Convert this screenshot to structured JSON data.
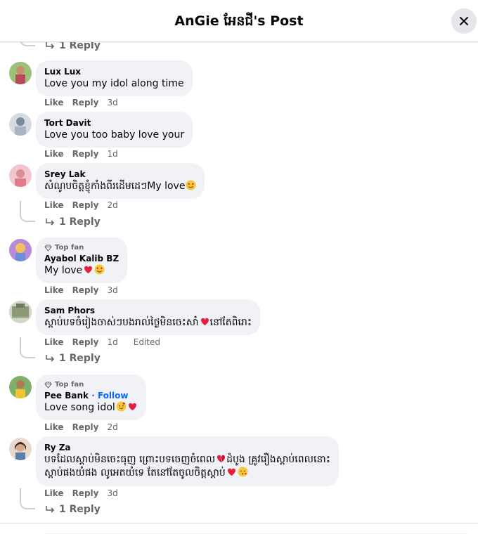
{
  "header": {
    "title": "AnGie អែនជី's Post"
  },
  "top_reply": {
    "label": "1 Reply"
  },
  "actions": {
    "like": "Like",
    "reply": "Reply"
  },
  "comments": [
    {
      "author": "Lux Lux",
      "text": "Love you my idol along time",
      "time": "3d"
    },
    {
      "author": "Tort Davit",
      "text": "Love you too baby love your",
      "time": "1d"
    },
    {
      "author": "Srey Lak",
      "text": "សំណូបចិត្តខ្ញុំកាំងពីរដើមដេៗMy love",
      "time": "2d",
      "reply_label": "1 Reply"
    },
    {
      "badge": "Top fan",
      "author": "Ayabol Kalib BZ",
      "text": "My love",
      "time": "3d"
    },
    {
      "author": "Sam Phors",
      "text": "ស្តាប់បទចំរៀងចាស់ៗបងរាល់ថ្ងៃមិនចេះសាំ",
      "text2": "នៅតែពិរោះ",
      "time": "1d",
      "edited": "Edited",
      "reply_label": "1 Reply"
    },
    {
      "badge": "Top fan",
      "author": "Pee Bank",
      "follow": "· Follow",
      "text": "Love song idol",
      "time": "2d"
    },
    {
      "author": "Ry Za",
      "text": "បទដែលស្តាប់មិនចេះធុញ ព្រោះបទចេញចំពេល",
      "text1b": "ដំបូង គ្រូវរឿងស្តាប់ពេលនោះ",
      "text2": "ស្តាប់ផងយំផង លូអេតយំទេ តែនៅតែចូលចិត្តស្តាប់",
      "time": "3d",
      "reply_label": "1 Reply"
    }
  ],
  "colors": {
    "bubble": "#f0f2f5",
    "meta": "#65676b",
    "link": "#0866ff",
    "heart": "#e41e3f"
  }
}
